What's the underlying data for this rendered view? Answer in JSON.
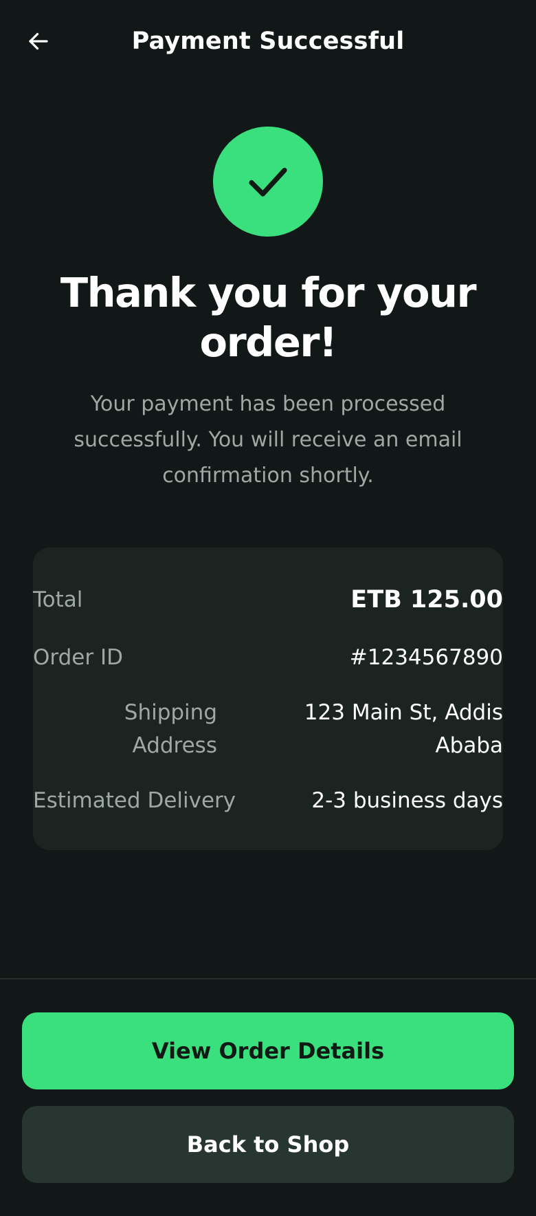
{
  "header": {
    "title": "Payment Successful",
    "back_icon": "arrow-left-icon"
  },
  "success": {
    "icon": "checkmark-icon",
    "accent_color": "#3ae07e"
  },
  "message": {
    "headline": "Thank you for your order!",
    "body": "Your payment has been processed successfully. You will receive an email confirmation shortly."
  },
  "summary": {
    "total_label": "Total",
    "total_value": "ETB 125.00",
    "order_id_label": "Order ID",
    "order_id_value": "#1234567890",
    "shipping_label": "Shipping Address",
    "shipping_value": "123 Main St, Addis Ababa",
    "delivery_label": "Estimated Delivery",
    "delivery_value": "2-3 business days"
  },
  "actions": {
    "primary_label": "View Order Details",
    "secondary_label": "Back to Shop"
  },
  "colors": {
    "background": "#111817",
    "card": "#1c2422",
    "secondary_button": "#283632",
    "muted_text": "#9fa8a5"
  }
}
